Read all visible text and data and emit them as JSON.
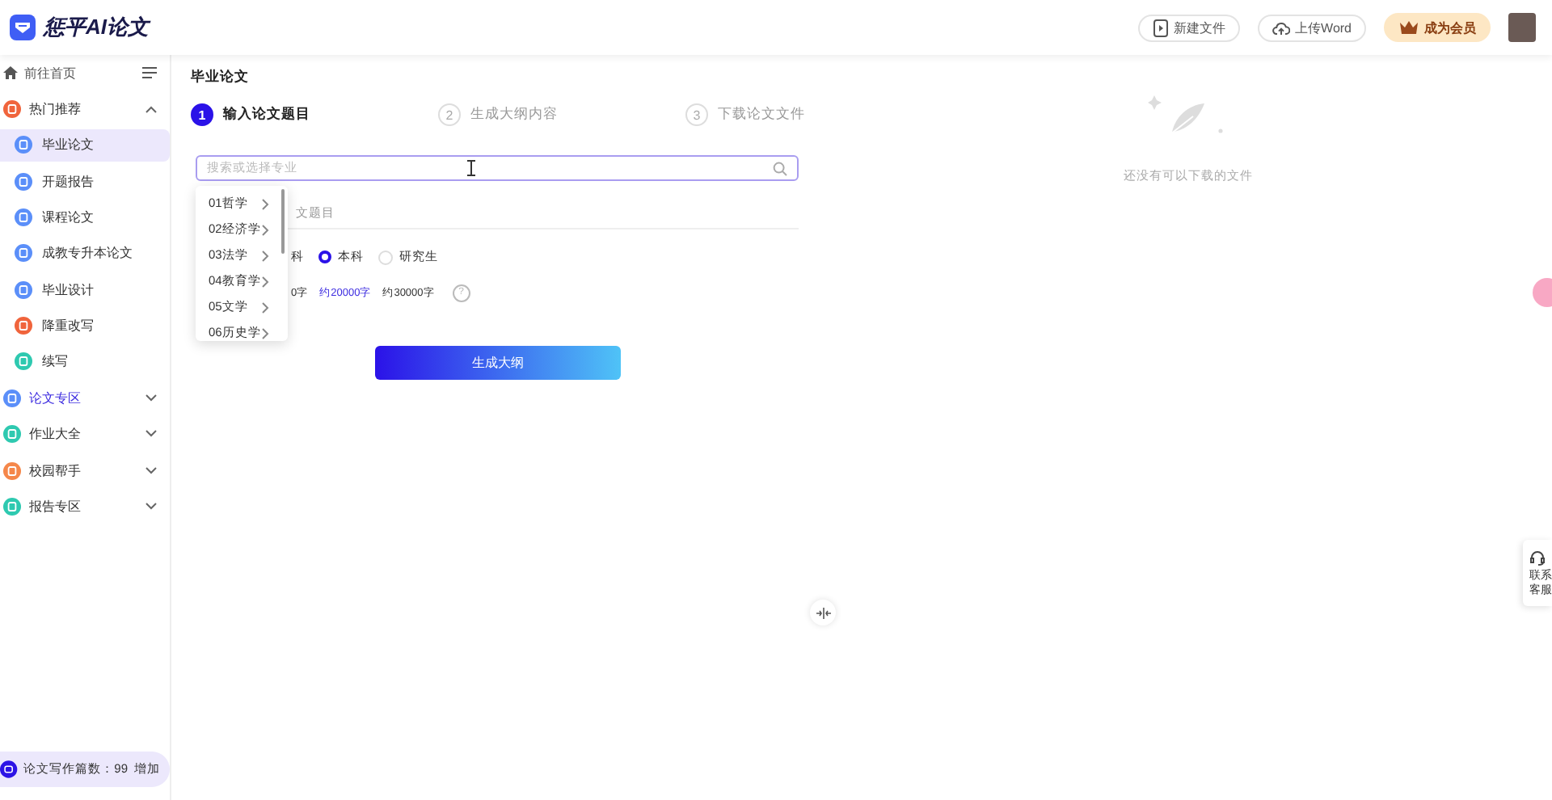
{
  "header": {
    "logo_text": "惩平AI论文",
    "buttons": [
      {
        "label": "新建文件",
        "kind": "file"
      },
      {
        "label": "上传Word",
        "kind": "upload"
      },
      {
        "label": "成为会员",
        "kind": "vip"
      }
    ]
  },
  "sidebar": {
    "home": "前往首页",
    "groups": [
      {
        "label": "热门推荐",
        "expanded": true,
        "selected": false,
        "color": "#f0643c",
        "children": [
          {
            "label": "毕业论文",
            "selected": true,
            "color": "#5b8ff9"
          },
          {
            "label": "开题报告",
            "selected": false,
            "color": "#5b8ff9"
          },
          {
            "label": "课程论文",
            "selected": false,
            "color": "#5b8ff9"
          },
          {
            "label": "成教专升本论文",
            "selected": false,
            "color": "#5b8ff9"
          },
          {
            "label": "毕业设计",
            "selected": false,
            "color": "#5b8ff9"
          },
          {
            "label": "降重改写",
            "selected": false,
            "color": "#f0643c"
          },
          {
            "label": "续写",
            "selected": false,
            "color": "#2ec9b0"
          }
        ]
      },
      {
        "label": "论文专区",
        "expanded": false,
        "selected": true,
        "color": "#5b8ff9"
      },
      {
        "label": "作业大全",
        "expanded": false,
        "selected": false,
        "color": "#2ec9b0"
      },
      {
        "label": "校园帮手",
        "expanded": false,
        "selected": false,
        "color": "#f5874a"
      },
      {
        "label": "报告专区",
        "expanded": false,
        "selected": false,
        "color": "#2ec9b0"
      }
    ],
    "footer": {
      "label": "论文写作篇数：99",
      "action": "增加"
    }
  },
  "main": {
    "title": "毕业论文",
    "steps": [
      {
        "number": "1",
        "label": "输入论文题目",
        "selected": true
      },
      {
        "number": "2",
        "label": "生成大纲内容",
        "selected": false
      },
      {
        "number": "3",
        "label": "下载论文文件",
        "selected": false
      }
    ],
    "major_field": {
      "placeholder": "搜索或选择专业"
    },
    "topic_field": {
      "placeholder": "文题目"
    },
    "degree_options": [
      {
        "label": "科",
        "selected": false
      },
      {
        "label": "本科",
        "selected": true
      },
      {
        "label": "研究生",
        "selected": false
      }
    ],
    "length_options": [
      {
        "label": "0字",
        "selected": false
      },
      {
        "label": "约20000字",
        "selected": true
      },
      {
        "label": "约30000字",
        "selected": false
      }
    ],
    "help_icon": "?",
    "submit": "生成大纲",
    "major_dropdown": [
      "01哲学",
      "02经济学",
      "03法学",
      "04教育学",
      "05文学",
      "06历史学"
    ]
  },
  "file_panel": {
    "empty_text": "还没有可以下载的文件"
  },
  "support": {
    "label": "联系客服"
  }
}
